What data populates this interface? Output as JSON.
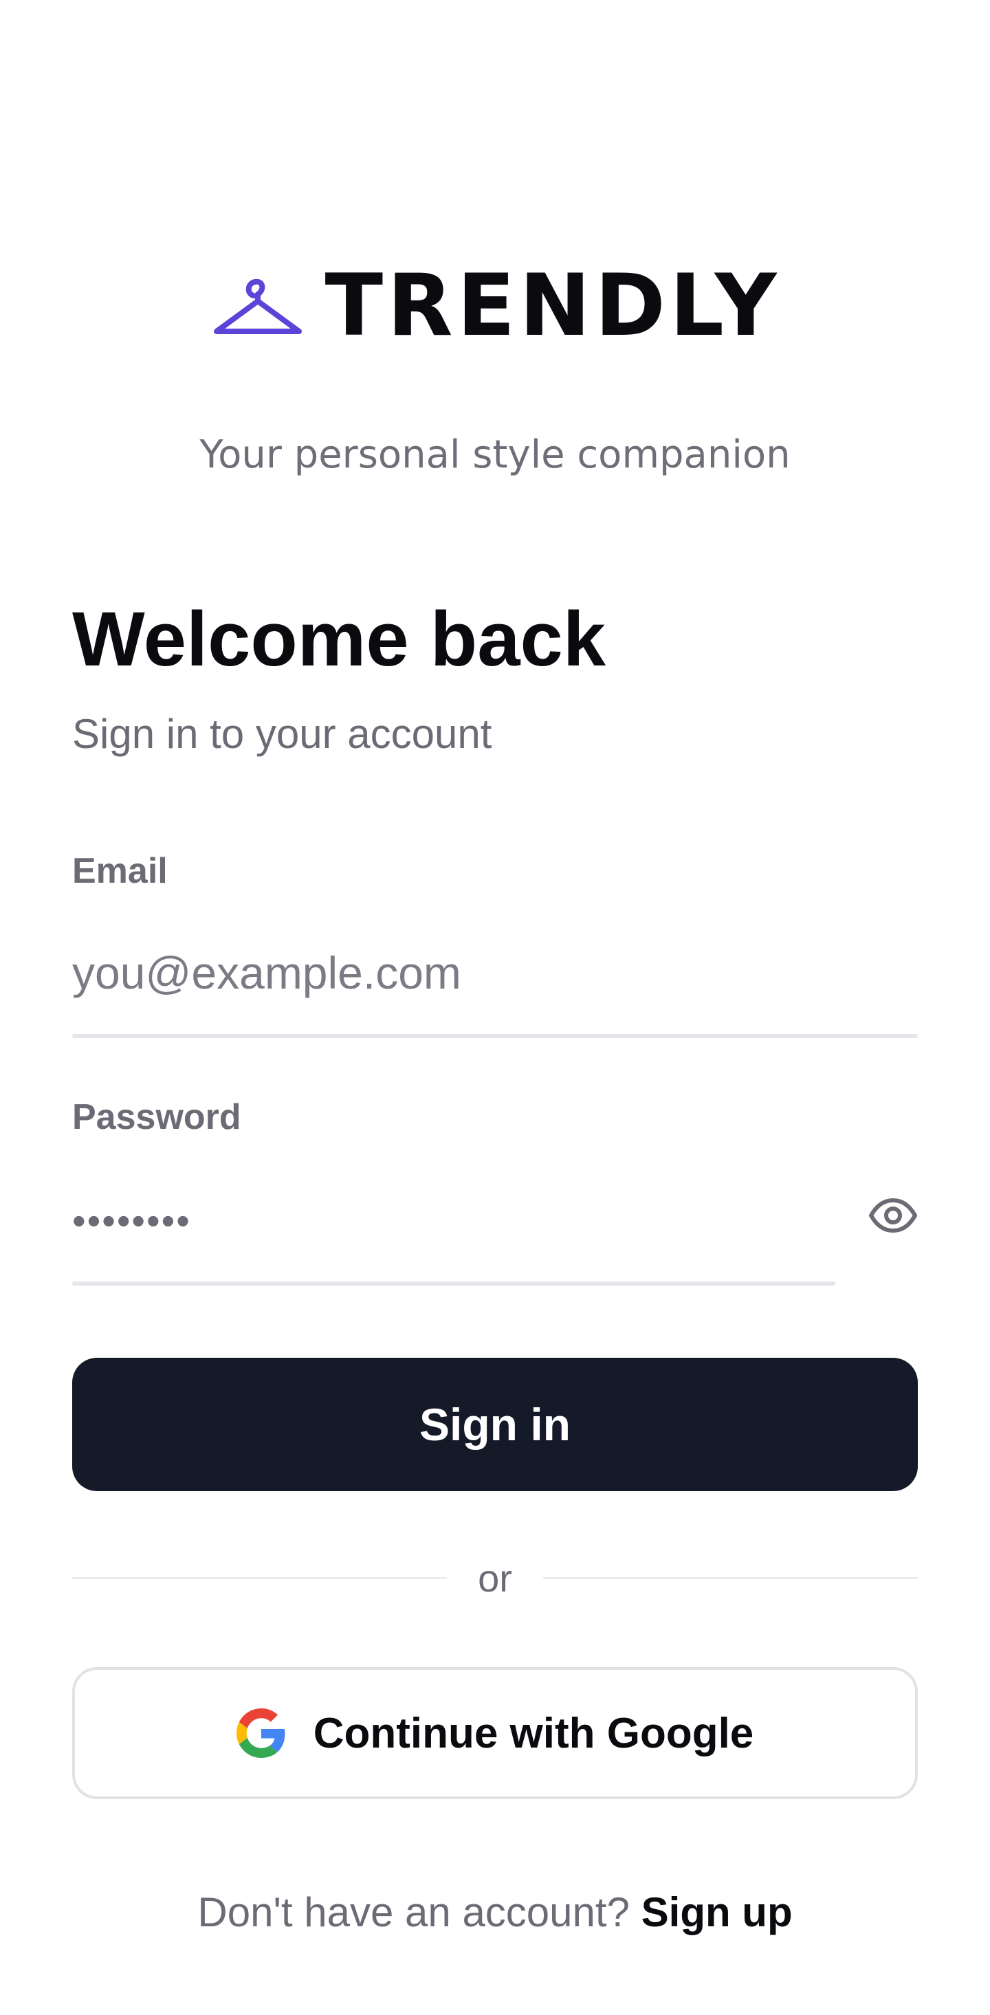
{
  "brand": {
    "name": "TRENDLY",
    "icon": "hanger-icon",
    "accent_color": "#5b45d9",
    "tagline": "Your personal style companion"
  },
  "header": {
    "title": "Welcome back",
    "subtitle": "Sign in to your account"
  },
  "form": {
    "email": {
      "label": "Email",
      "placeholder": "you@example.com",
      "value": ""
    },
    "password": {
      "label": "Password",
      "value": "••••••••",
      "toggle_icon": "eye-icon"
    },
    "submit_label": "Sign in",
    "submit_color": "#151a28"
  },
  "divider": {
    "text": "or"
  },
  "social": {
    "google_label": "Continue with Google",
    "google_icon": "google-icon"
  },
  "footer": {
    "prompt": "Don't have an account?",
    "link_label": "Sign up"
  }
}
